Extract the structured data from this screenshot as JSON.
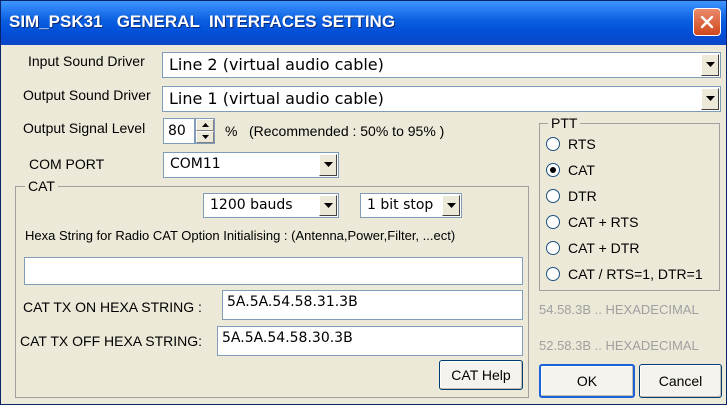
{
  "window": {
    "title": "SIM_PSK31   GENERAL  INTERFACES SETTING"
  },
  "input_sound_driver": {
    "label": "Input Sound Driver",
    "value": "Line 2 (virtual audio cable)"
  },
  "output_sound_driver": {
    "label": "Output Sound Driver",
    "value": "Line 1 (virtual audio cable)"
  },
  "output_signal_level": {
    "label": "Output Signal Level",
    "value": "80",
    "unit": "%",
    "note": "(Recommended : 50% to 95% )"
  },
  "com_port": {
    "label": "COM PORT",
    "value": "COM11"
  },
  "cat": {
    "group_title": "CAT",
    "baud_rate": "1200 bauds",
    "stop_bits": "1 bit stop",
    "init_label": "Hexa String for Radio CAT Option Initialising :  (Antenna,Power,Filter, ...ect)",
    "init_value": "",
    "tx_on_label": "CAT TX ON HEXA STRING :",
    "tx_on_value": "5A.5A.54.58.31.3B",
    "tx_off_label": "CAT TX OFF HEXA STRING:",
    "tx_off_value": "5A.5A.54.58.30.3B",
    "help_label": "CAT Help"
  },
  "ptt": {
    "group_title": "PTT",
    "selected": "CAT",
    "options": [
      "RTS",
      "CAT",
      "DTR",
      "CAT + RTS",
      "CAT + DTR",
      "CAT / RTS=1, DTR=1"
    ]
  },
  "hexa_hints": {
    "on": "54.58.3B .. HEXADECIMAL",
    "off": "52.58.3B .. HEXADECIMAL"
  },
  "buttons": {
    "ok": "OK",
    "cancel": "Cancel"
  },
  "colors": {
    "titlebar": "#0a5ee0",
    "dialog_bg": "#ece9d8",
    "disabled_text": "#a0a0a0"
  }
}
